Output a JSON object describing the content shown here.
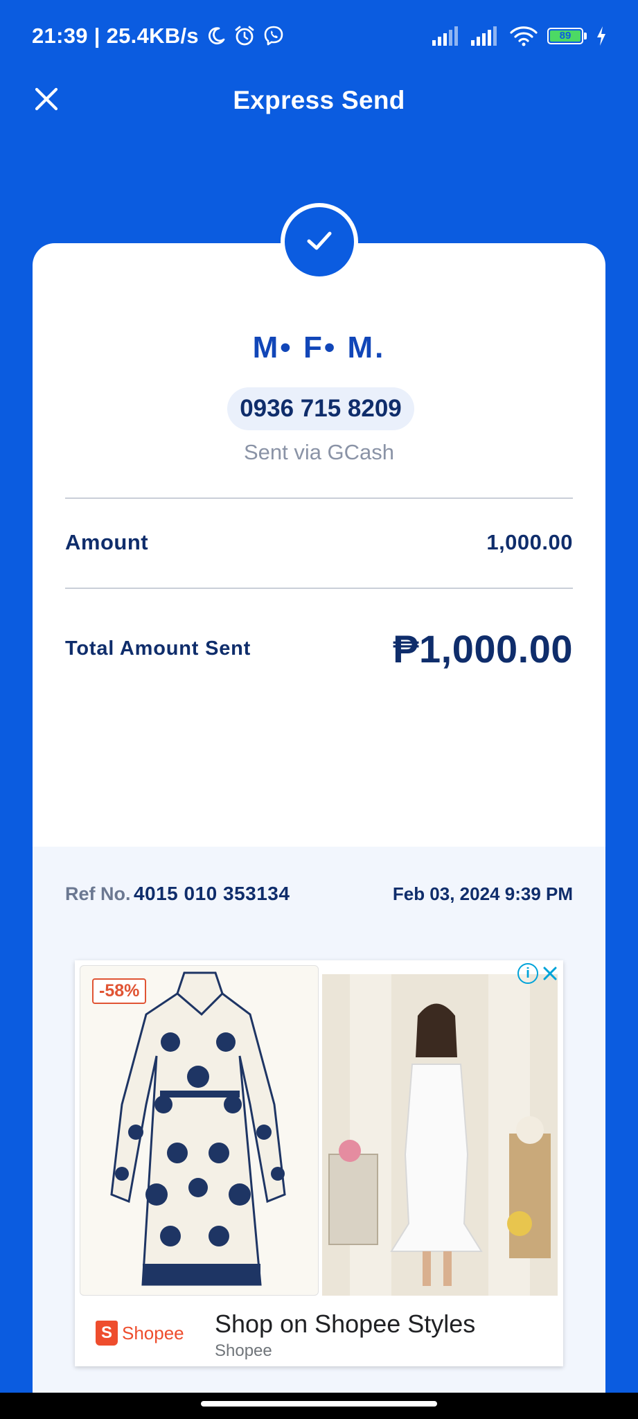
{
  "status_bar": {
    "time_speed": "21:39 | 25.4KB/s",
    "battery_level": "89",
    "icons": [
      "moon-icon",
      "alarm-icon",
      "viber-icon",
      "signal-icon",
      "signal-icon",
      "wifi-icon",
      "battery-icon",
      "charging-icon"
    ]
  },
  "header": {
    "title": "Express Send",
    "close_icon": "close-icon"
  },
  "receipt": {
    "status_icon": "check-icon",
    "recipient_name": "M• F• M.",
    "recipient_number": "0936 715 8209",
    "sent_via": "Sent via GCash",
    "amount_label": "Amount",
    "amount_value": "1,000.00",
    "total_label": "Total Amount Sent",
    "total_value": "₱1,000.00",
    "ref_label": "Ref No.",
    "ref_number": "4015 010 353134",
    "date": "Feb 03, 2024 9:39 PM"
  },
  "ad": {
    "discount": "-58%",
    "headline": "Shop on Shopee Styles",
    "advertiser": "Shopee",
    "brand_logo_text": "Shopee",
    "brand_logo_letter": "S",
    "info_label": "i",
    "colors": {
      "brand": "#ee4d2d",
      "info": "#00a3d9"
    }
  },
  "theme": {
    "primary": "#0b5ce0",
    "text_dark": "#0f2d6b",
    "text_muted": "#8a93a6"
  }
}
